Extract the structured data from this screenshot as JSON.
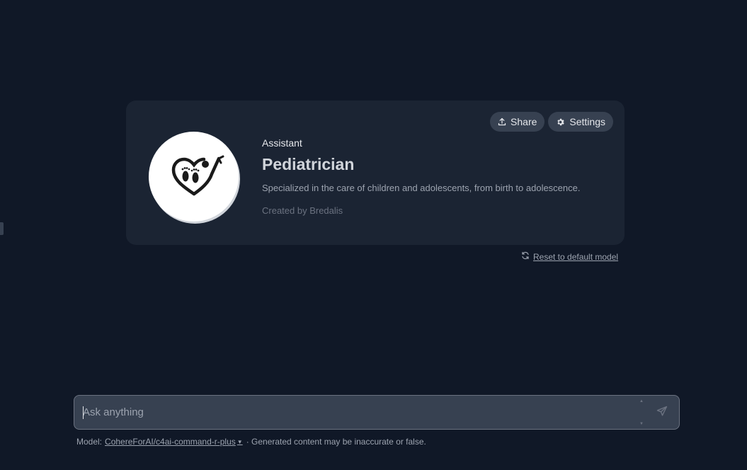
{
  "assistant_card": {
    "share_label": "Share",
    "settings_label": "Settings",
    "kicker": "Assistant",
    "name": "Pediatrician",
    "description": "Specialized in the care of children and adolescents, from birth to adolescence.",
    "created_by": "Created by Bredalis",
    "avatar_icon": "heart-stethoscope-baby-feet-icon"
  },
  "reset": {
    "label": "Reset to default model"
  },
  "chat": {
    "placeholder": "Ask anything",
    "value": ""
  },
  "footer": {
    "model_prefix": "Model:",
    "model_name": "CohereForAI/c4ai-command-r-plus",
    "note": "· Generated content may be inaccurate or false."
  },
  "colors": {
    "background": "#101827",
    "card": "#1b2433",
    "pill": "#374151",
    "input": "#374151"
  }
}
